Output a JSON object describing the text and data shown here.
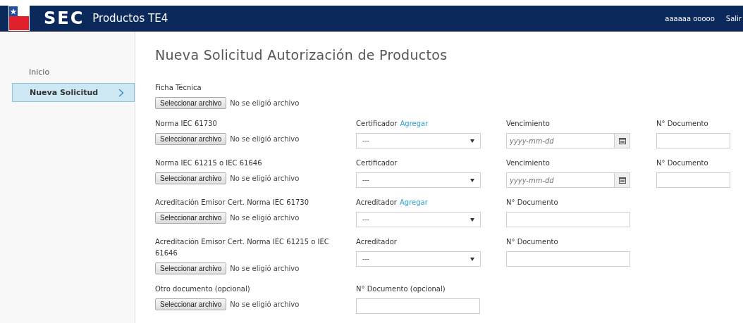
{
  "header": {
    "logo_text": "SEC",
    "app_title": "Productos TE4",
    "user": "aaaaaa ooooo",
    "logout": "Salir"
  },
  "sidebar": {
    "items": [
      {
        "label": "Inicio",
        "selected": false
      },
      {
        "label": "Nueva Solicitud",
        "selected": true
      }
    ]
  },
  "page_title": "Nueva Solicitud Autorización de Productos",
  "rows": [
    {
      "file": {
        "label": "Ficha Técnica",
        "button": "Seleccionar archivo",
        "status": "No se eligió archivo"
      },
      "fields": []
    },
    {
      "file": {
        "label": "Norma IEC 61730",
        "button": "Seleccionar archivo",
        "status": "No se eligió archivo"
      },
      "fields": [
        {
          "kind": "select",
          "label": "Certificador",
          "link": "Agregar",
          "value": "---"
        },
        {
          "kind": "date",
          "label": "Vencimiento",
          "placeholder": "yyyy-mm-dd"
        },
        {
          "kind": "text",
          "label": "N° Documento"
        }
      ]
    },
    {
      "file": {
        "label": "Norma IEC 61215 o IEC 61646",
        "button": "Seleccionar archivo",
        "status": "No se eligió archivo"
      },
      "fields": [
        {
          "kind": "select",
          "label": "Certificador",
          "value": "---"
        },
        {
          "kind": "date",
          "label": "Vencimiento",
          "placeholder": "yyyy-mm-dd"
        },
        {
          "kind": "text",
          "label": "N° Documento"
        }
      ]
    },
    {
      "file": {
        "label": "Acreditación Emisor Cert. Norma IEC 61730",
        "button": "Seleccionar archivo",
        "status": "No se eligió archivo"
      },
      "fields": [
        {
          "kind": "select",
          "label": "Acreditador",
          "link": "Agregar",
          "value": "---"
        },
        {
          "kind": "text",
          "label": "N° Documento"
        }
      ]
    },
    {
      "file": {
        "label": "Acreditación Emisor Cert. Norma IEC 61215 o IEC 61646",
        "button": "Seleccionar archivo",
        "status": "No se eligió archivo"
      },
      "fields": [
        {
          "kind": "select",
          "label": "Acreditador",
          "value": "---"
        },
        {
          "kind": "text",
          "label": "N° Documento"
        }
      ]
    },
    {
      "file": {
        "label": "Otro documento (opcional)",
        "button": "Seleccionar archivo",
        "status": "No se eligió archivo"
      },
      "fields": [
        {
          "kind": "text",
          "label": "N° Documento (opcional)"
        }
      ]
    }
  ]
}
